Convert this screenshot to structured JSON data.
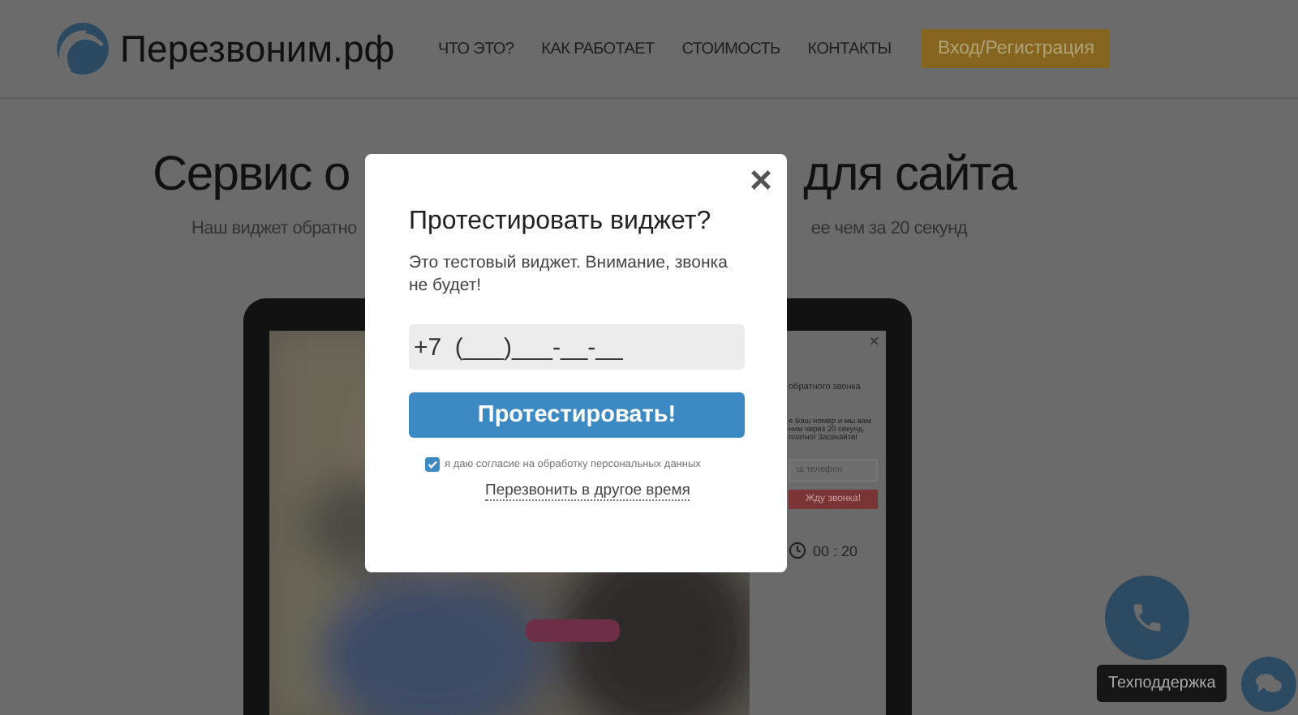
{
  "header": {
    "logo_text": "Перезвоним.рф",
    "nav": [
      {
        "label": "ЧТО ЭТО?"
      },
      {
        "label": "КАК РАБОТАЕТ"
      },
      {
        "label": "СТОИМОСТЬ"
      },
      {
        "label": "КОНТАКТЫ"
      }
    ],
    "login_button": "Вход/Регистрация"
  },
  "hero": {
    "title_left": "Сервис о",
    "title_right": "для сайта",
    "subtitle_left": "Наш виджет обратно",
    "subtitle_right": "ее чем за 20 секунд"
  },
  "demo_widget": {
    "close": "×",
    "title": "обратного звонка",
    "lines": [
      "е Ваш номер и мы вам",
      "ним через 20 секунд.",
      "платно! Засекайте!"
    ],
    "phone_placeholder": "ш телефон",
    "button": "Жду звонка!",
    "timer": "00 : 20"
  },
  "modal": {
    "close": "×",
    "title": "Протестировать виджет?",
    "text": "Это тестовый виджет. Внимание, звонка не будет!",
    "phone_placeholder": "+7  (___)___-__-__",
    "submit": "Протестировать!",
    "consent": {
      "label": "я даю согласие на обработку персональных данных",
      "checked": true
    },
    "later_link": "Перезвонить в другое время"
  },
  "support": {
    "tooltip": "Техподдержка"
  }
}
